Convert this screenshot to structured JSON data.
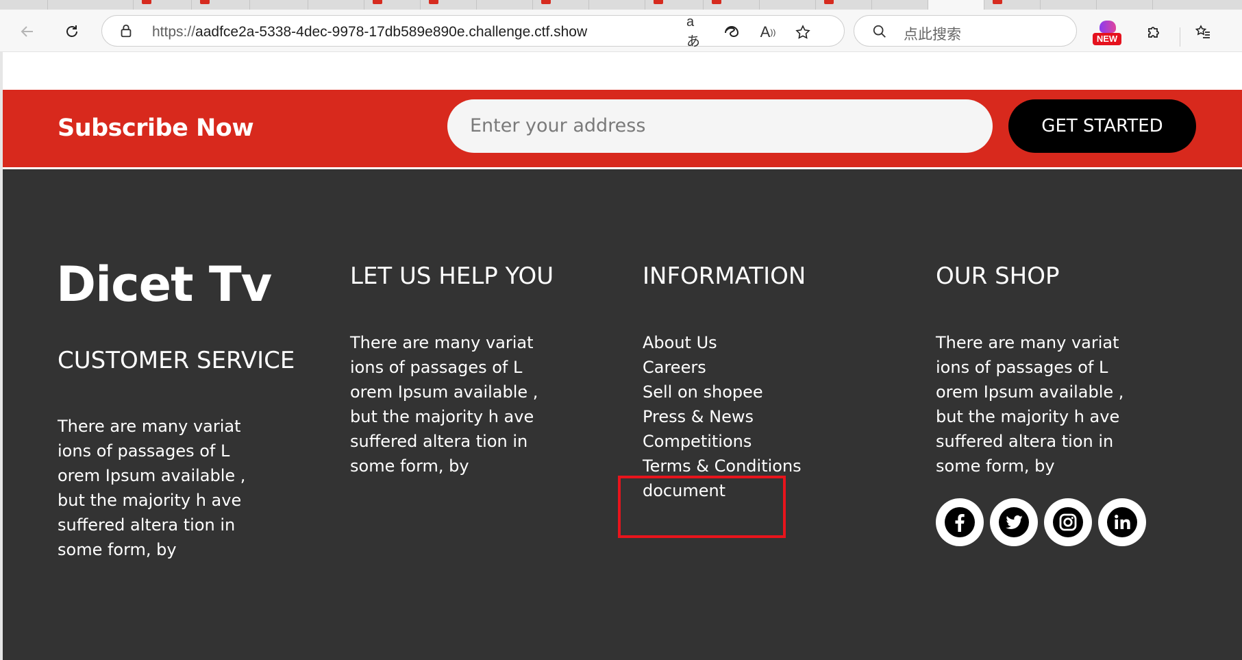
{
  "browser": {
    "url_scheme": "https://",
    "url_host": "aadfce2a-5338-4dec-9978-17db589e890e.challenge.ctf.show",
    "search_placeholder": "点此搜索",
    "translate_icon_text": "aあ",
    "read_aloud_icon_text": "A",
    "new_badge": "NEW"
  },
  "subscribe": {
    "title": "Subscribe Now",
    "input_placeholder": "Enter your address",
    "button_label": "GET STARTED",
    "bg_color": "#d8291d"
  },
  "footer": {
    "logo": "Dicet Tv",
    "customer_service": {
      "heading": "CUSTOMER SERVICE",
      "text": "There are many variat\nions of passages of L\norem Ipsum available ,\nbut the majority h ave\nsuffered altera tion in\nsome form, by"
    },
    "help": {
      "heading": "LET US HELP YOU",
      "text": "There are many variat\nions of passages of L\norem Ipsum available ,\nbut the majority h ave\nsuffered altera tion in\nsome form, by"
    },
    "information": {
      "heading": "INFORMATION",
      "links": [
        "About Us",
        "Careers",
        "Sell on shopee",
        "Press & News",
        "Competitions",
        "Terms & Conditions",
        "document"
      ]
    },
    "shop": {
      "heading": "OUR SHOP",
      "text": "There are many variat\nions of passages of L\norem Ipsum available ,\nbut the majority h ave\nsuffered altera tion in\nsome form, by",
      "social": [
        "facebook-icon",
        "twitter-icon",
        "instagram-icon",
        "linkedin-icon"
      ]
    },
    "bg_color": "#333333"
  }
}
